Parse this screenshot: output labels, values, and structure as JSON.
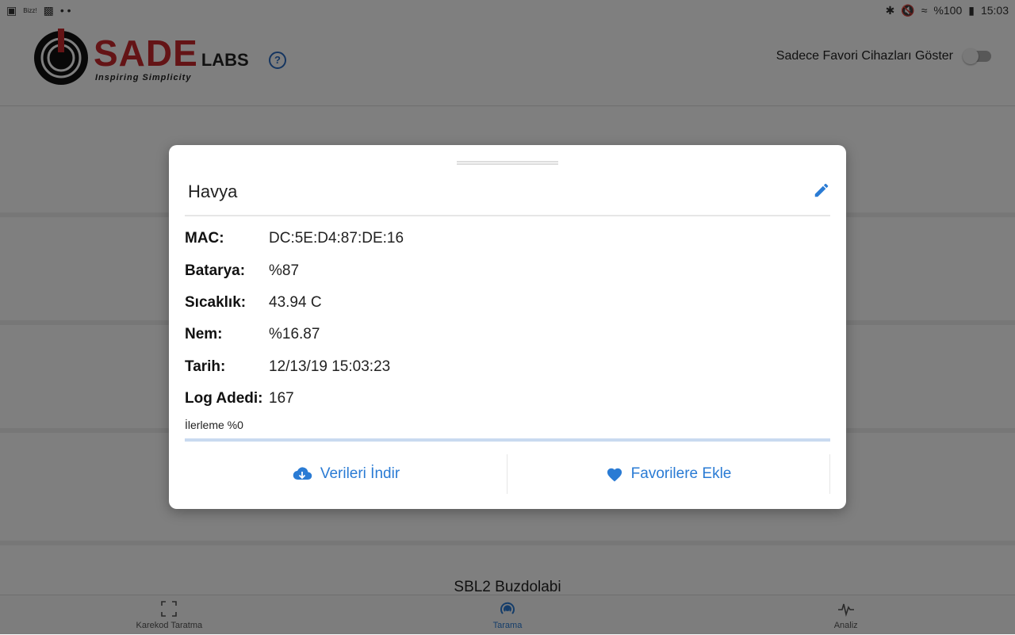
{
  "statusbar": {
    "left_app_label": "Bizz!",
    "dots": "• •",
    "battery": "%100",
    "time": "15:03"
  },
  "header": {
    "logo_main": "SADE",
    "logo_secondary": "LABS",
    "logo_tagline": "Inspiring Simplicity",
    "help_icon_glyph": "?",
    "favorites_toggle_label": "Sadece Favori Cihazları Göster"
  },
  "background_list": {
    "visible_item_title": "SBL2  Buzdolabi"
  },
  "dialog": {
    "title": "Havya",
    "rows": [
      {
        "label": "MAC:",
        "value": "DC:5E:D4:87:DE:16"
      },
      {
        "label": "Batarya:",
        "value": "%87"
      },
      {
        "label": "Sıcaklık:",
        "value": "43.94 C"
      },
      {
        "label": "Nem:",
        "value": "%16.87"
      },
      {
        "label": "Tarih:",
        "value": "12/13/19 15:03:23"
      },
      {
        "label": "Log Adedi:",
        "value": "167"
      }
    ],
    "progress_label": "İlerleme %0",
    "progress_value": 0,
    "download_label": "Verileri İndir",
    "favorite_label": "Favorilere Ekle"
  },
  "bottom_nav": {
    "items": [
      {
        "label": "Karekod Taratma",
        "icon": "qr-scan-icon"
      },
      {
        "label": "Tarama",
        "icon": "radar-icon"
      },
      {
        "label": "Analiz",
        "icon": "pulse-icon"
      }
    ]
  },
  "colors": {
    "accent": "#2a7bd4",
    "brand_red": "#c9282d"
  }
}
